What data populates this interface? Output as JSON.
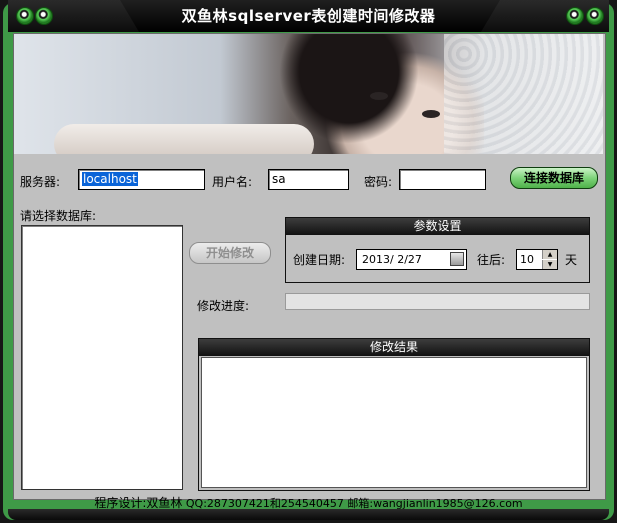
{
  "window": {
    "title": "双鱼林sqlserver表创建时间修改器"
  },
  "login": {
    "server_label": "服务器:",
    "server_value": "localhost",
    "user_label": "用户名:",
    "user_value": "sa",
    "password_label": "密码:",
    "password_value": "",
    "connect_button": "连接数据库"
  },
  "database": {
    "select_label": "请选择数据库:",
    "items": []
  },
  "actions": {
    "start_button": "开始修改"
  },
  "params": {
    "header": "参数设置",
    "date_label": "创建日期:",
    "date_value": "2013/ 2/27",
    "after_label": "往后:",
    "days_value": "10",
    "days_unit": "天"
  },
  "progress": {
    "label": "修改进度:",
    "value": 0
  },
  "result": {
    "header": "修改结果",
    "text": ""
  },
  "footer": {
    "designer": "程序设计:双鱼林",
    "contact": " QQ:287307421和254540457 邮箱:wangjianlin1985@126.com"
  },
  "colors": {
    "frame_green": "#3f9a47",
    "client_gray": "#c0c0c0",
    "title_black": "#000000"
  }
}
